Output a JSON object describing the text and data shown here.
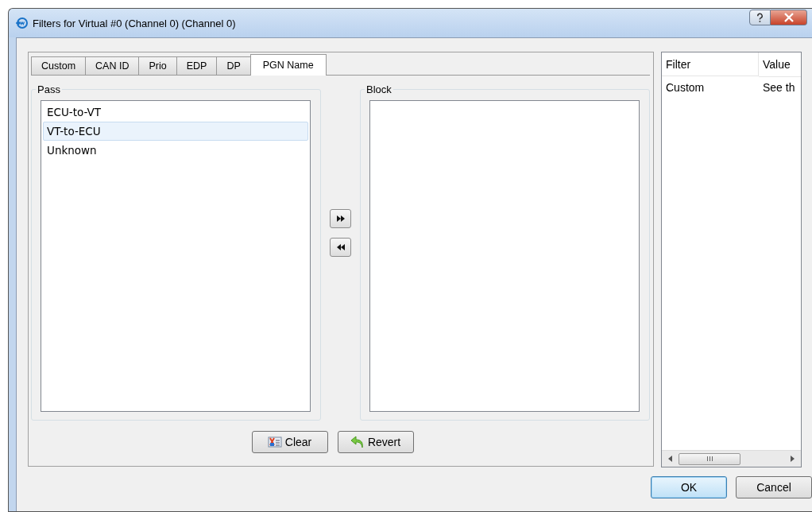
{
  "window": {
    "title": "Filters for Virtual #0 (Channel 0) (Channel 0)"
  },
  "tabs": [
    {
      "label": "Custom",
      "selected": false
    },
    {
      "label": "CAN ID",
      "selected": false
    },
    {
      "label": "Prio",
      "selected": false
    },
    {
      "label": "EDP",
      "selected": false
    },
    {
      "label": "DP",
      "selected": false
    },
    {
      "label": "PGN Name",
      "selected": true
    }
  ],
  "pass": {
    "label": "Pass",
    "items": [
      {
        "label": "ECU-to-VT",
        "selected": false
      },
      {
        "label": "VT-to-ECU",
        "selected": true
      },
      {
        "label": "Unknown",
        "selected": false
      }
    ]
  },
  "block": {
    "label": "Block"
  },
  "actions": [
    {
      "kind": "clear",
      "label": "Clear"
    },
    {
      "kind": "revert",
      "label": "Revert"
    }
  ],
  "filter_table": {
    "columns": [
      "Filter",
      "Value"
    ],
    "rows": [
      [
        "Custom",
        "See th"
      ]
    ]
  },
  "buttons": [
    {
      "label": "OK",
      "default": true
    },
    {
      "label": "Cancel",
      "default": false
    }
  ]
}
